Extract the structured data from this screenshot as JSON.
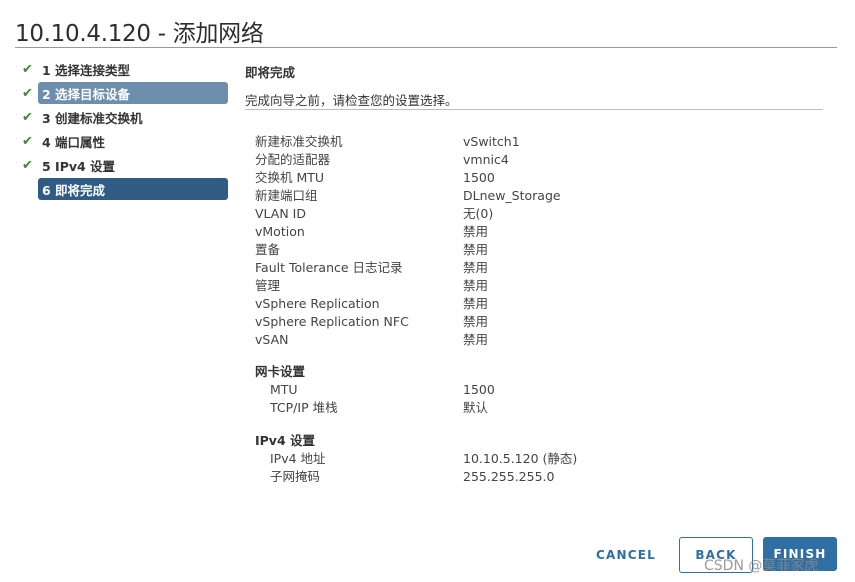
{
  "dialog": {
    "title": "10.10.4.120 - 添加网络"
  },
  "steps": [
    {
      "label": "1 选择连接类型",
      "done": true,
      "state": ""
    },
    {
      "label": "2 选择目标设备",
      "done": true,
      "state": "selected"
    },
    {
      "label": "3 创建标准交换机",
      "done": true,
      "state": ""
    },
    {
      "label": "4 端口属性",
      "done": true,
      "state": ""
    },
    {
      "label": "5 IPv4 设置",
      "done": true,
      "state": ""
    },
    {
      "label": "6 即将完成",
      "done": false,
      "state": "current"
    }
  ],
  "content": {
    "heading": "即将完成",
    "subtitle": "完成向导之前，请检查您的设置选择。"
  },
  "summary": [
    {
      "key": "新建标准交换机",
      "value": "vSwitch1"
    },
    {
      "key": "分配的适配器",
      "value": "vmnic4"
    },
    {
      "key": "交换机 MTU",
      "value": "1500"
    },
    {
      "key": "新建端口组",
      "value": "DLnew_Storage"
    },
    {
      "key": "VLAN ID",
      "value": "无(0)"
    },
    {
      "key": "vMotion",
      "value": "禁用"
    },
    {
      "key": "置备",
      "value": "禁用"
    },
    {
      "key": "Fault Tolerance 日志记录",
      "value": "禁用"
    },
    {
      "key": "管理",
      "value": "禁用"
    },
    {
      "key": "vSphere Replication",
      "value": "禁用"
    },
    {
      "key": "vSphere Replication NFC",
      "value": "禁用"
    },
    {
      "key": "vSAN",
      "value": "禁用"
    }
  ],
  "nic": {
    "heading": "网卡设置",
    "rows": [
      {
        "key": "MTU",
        "value": "1500"
      },
      {
        "key": "TCP/IP 堆栈",
        "value": "默认"
      }
    ]
  },
  "ipv4": {
    "heading": "IPv4 设置",
    "rows": [
      {
        "key": "IPv4 地址",
        "value": "10.10.5.120 (静态)"
      },
      {
        "key": "子网掩码",
        "value": "255.255.255.0"
      }
    ]
  },
  "buttons": {
    "cancel": "CANCEL",
    "back": "BACK",
    "finish": "FINISH"
  },
  "watermark": "CSDN @莫菲家虎",
  "icons": {
    "done": "check-icon"
  },
  "colors": {
    "accent": "#2f6fa3",
    "current_step": "#2f5b84",
    "selected_step": "#6d8fad",
    "check": "#3a8a2f"
  }
}
